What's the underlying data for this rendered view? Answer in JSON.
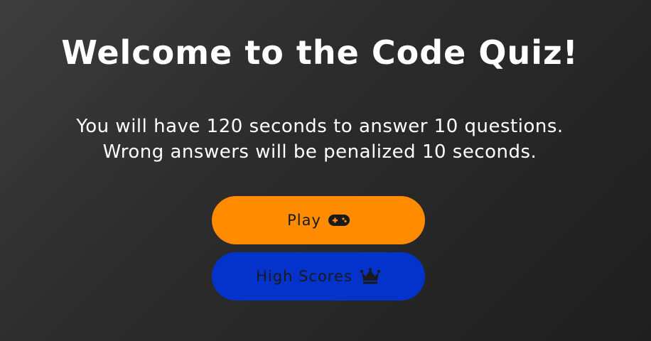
{
  "page": {
    "title": "Welcome to the Code Quiz!",
    "intro_line1": "You will have 120 seconds to answer 10 questions.",
    "intro_line2": "Wrong answers will be penalized 10 seconds."
  },
  "buttons": {
    "play": {
      "label": "Play",
      "icon": "gamepad-icon",
      "color": "#ff8c00"
    },
    "high_scores": {
      "label": "High Scores",
      "icon": "crown-icon",
      "color": "#0433cc"
    }
  },
  "theme": {
    "background": "#2c2c2c",
    "text": "#ffffff",
    "button_text": "#1a1a1a"
  }
}
